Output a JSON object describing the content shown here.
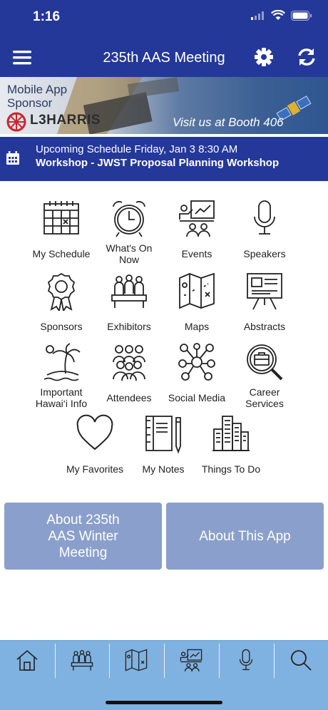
{
  "status": {
    "time": "1:16"
  },
  "nav": {
    "title": "235th AAS Meeting"
  },
  "banner": {
    "line1": "Mobile App",
    "line2": "Sponsor",
    "logo": "L3HARRIS",
    "visit": "Visit us at Booth 406"
  },
  "upcoming": {
    "line1": "Upcoming Schedule Friday, Jan 3 8:30 AM",
    "line2": "Workshop - JWST Proposal Planning Workshop"
  },
  "tiles": [
    {
      "label": "My Schedule",
      "icon": "calendar-icon"
    },
    {
      "label": "What's On\nNow",
      "icon": "alarm-clock-icon"
    },
    {
      "label": "Events",
      "icon": "presentation-icon"
    },
    {
      "label": "Speakers",
      "icon": "microphone-icon"
    },
    {
      "label": "Sponsors",
      "icon": "award-ribbon-icon"
    },
    {
      "label": "Exhibitors",
      "icon": "booth-people-icon"
    },
    {
      "label": "Maps",
      "icon": "map-icon"
    },
    {
      "label": "Abstracts",
      "icon": "easel-board-icon"
    },
    {
      "label": "Important\nHawai‘i Info",
      "icon": "island-palm-icon"
    },
    {
      "label": "Attendees",
      "icon": "group-people-icon"
    },
    {
      "label": "Social Media",
      "icon": "network-icon"
    },
    {
      "label": "Career\nServices",
      "icon": "briefcase-search-icon"
    },
    {
      "label": "My Favorites",
      "icon": "heart-icon"
    },
    {
      "label": "My Notes",
      "icon": "notebook-icon"
    },
    {
      "label": "Things To Do",
      "icon": "city-buildings-icon"
    }
  ],
  "buttons": {
    "about_meeting": "About 235th\nAAS Winter\nMeeting",
    "about_app": "About This App"
  },
  "tabbar": [
    "home-icon",
    "booth-people-icon",
    "map-icon",
    "presentation-icon",
    "microphone-icon",
    "search-icon"
  ],
  "colors": {
    "navy": "#24389a",
    "button": "#8a9fcc",
    "tabbar": "#7fb2e0"
  }
}
